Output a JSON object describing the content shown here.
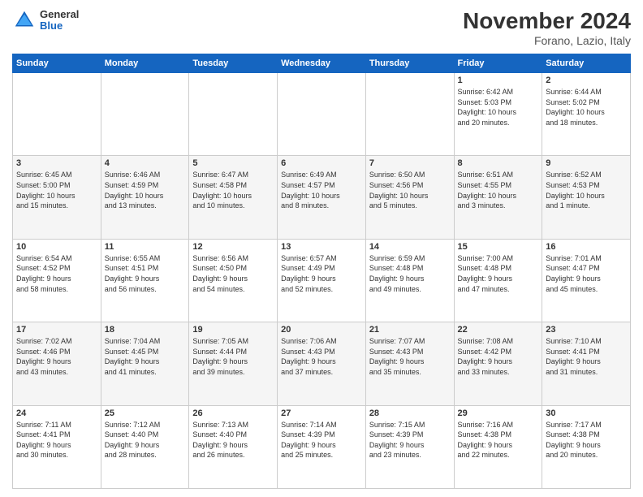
{
  "header": {
    "logo_general": "General",
    "logo_blue": "Blue",
    "month_title": "November 2024",
    "location": "Forano, Lazio, Italy"
  },
  "calendar": {
    "days_of_week": [
      "Sunday",
      "Monday",
      "Tuesday",
      "Wednesday",
      "Thursday",
      "Friday",
      "Saturday"
    ],
    "weeks": [
      [
        {
          "day": "",
          "info": ""
        },
        {
          "day": "",
          "info": ""
        },
        {
          "day": "",
          "info": ""
        },
        {
          "day": "",
          "info": ""
        },
        {
          "day": "",
          "info": ""
        },
        {
          "day": "1",
          "info": "Sunrise: 6:42 AM\nSunset: 5:03 PM\nDaylight: 10 hours\nand 20 minutes."
        },
        {
          "day": "2",
          "info": "Sunrise: 6:44 AM\nSunset: 5:02 PM\nDaylight: 10 hours\nand 18 minutes."
        }
      ],
      [
        {
          "day": "3",
          "info": "Sunrise: 6:45 AM\nSunset: 5:00 PM\nDaylight: 10 hours\nand 15 minutes."
        },
        {
          "day": "4",
          "info": "Sunrise: 6:46 AM\nSunset: 4:59 PM\nDaylight: 10 hours\nand 13 minutes."
        },
        {
          "day": "5",
          "info": "Sunrise: 6:47 AM\nSunset: 4:58 PM\nDaylight: 10 hours\nand 10 minutes."
        },
        {
          "day": "6",
          "info": "Sunrise: 6:49 AM\nSunset: 4:57 PM\nDaylight: 10 hours\nand 8 minutes."
        },
        {
          "day": "7",
          "info": "Sunrise: 6:50 AM\nSunset: 4:56 PM\nDaylight: 10 hours\nand 5 minutes."
        },
        {
          "day": "8",
          "info": "Sunrise: 6:51 AM\nSunset: 4:55 PM\nDaylight: 10 hours\nand 3 minutes."
        },
        {
          "day": "9",
          "info": "Sunrise: 6:52 AM\nSunset: 4:53 PM\nDaylight: 10 hours\nand 1 minute."
        }
      ],
      [
        {
          "day": "10",
          "info": "Sunrise: 6:54 AM\nSunset: 4:52 PM\nDaylight: 9 hours\nand 58 minutes."
        },
        {
          "day": "11",
          "info": "Sunrise: 6:55 AM\nSunset: 4:51 PM\nDaylight: 9 hours\nand 56 minutes."
        },
        {
          "day": "12",
          "info": "Sunrise: 6:56 AM\nSunset: 4:50 PM\nDaylight: 9 hours\nand 54 minutes."
        },
        {
          "day": "13",
          "info": "Sunrise: 6:57 AM\nSunset: 4:49 PM\nDaylight: 9 hours\nand 52 minutes."
        },
        {
          "day": "14",
          "info": "Sunrise: 6:59 AM\nSunset: 4:48 PM\nDaylight: 9 hours\nand 49 minutes."
        },
        {
          "day": "15",
          "info": "Sunrise: 7:00 AM\nSunset: 4:48 PM\nDaylight: 9 hours\nand 47 minutes."
        },
        {
          "day": "16",
          "info": "Sunrise: 7:01 AM\nSunset: 4:47 PM\nDaylight: 9 hours\nand 45 minutes."
        }
      ],
      [
        {
          "day": "17",
          "info": "Sunrise: 7:02 AM\nSunset: 4:46 PM\nDaylight: 9 hours\nand 43 minutes."
        },
        {
          "day": "18",
          "info": "Sunrise: 7:04 AM\nSunset: 4:45 PM\nDaylight: 9 hours\nand 41 minutes."
        },
        {
          "day": "19",
          "info": "Sunrise: 7:05 AM\nSunset: 4:44 PM\nDaylight: 9 hours\nand 39 minutes."
        },
        {
          "day": "20",
          "info": "Sunrise: 7:06 AM\nSunset: 4:43 PM\nDaylight: 9 hours\nand 37 minutes."
        },
        {
          "day": "21",
          "info": "Sunrise: 7:07 AM\nSunset: 4:43 PM\nDaylight: 9 hours\nand 35 minutes."
        },
        {
          "day": "22",
          "info": "Sunrise: 7:08 AM\nSunset: 4:42 PM\nDaylight: 9 hours\nand 33 minutes."
        },
        {
          "day": "23",
          "info": "Sunrise: 7:10 AM\nSunset: 4:41 PM\nDaylight: 9 hours\nand 31 minutes."
        }
      ],
      [
        {
          "day": "24",
          "info": "Sunrise: 7:11 AM\nSunset: 4:41 PM\nDaylight: 9 hours\nand 30 minutes."
        },
        {
          "day": "25",
          "info": "Sunrise: 7:12 AM\nSunset: 4:40 PM\nDaylight: 9 hours\nand 28 minutes."
        },
        {
          "day": "26",
          "info": "Sunrise: 7:13 AM\nSunset: 4:40 PM\nDaylight: 9 hours\nand 26 minutes."
        },
        {
          "day": "27",
          "info": "Sunrise: 7:14 AM\nSunset: 4:39 PM\nDaylight: 9 hours\nand 25 minutes."
        },
        {
          "day": "28",
          "info": "Sunrise: 7:15 AM\nSunset: 4:39 PM\nDaylight: 9 hours\nand 23 minutes."
        },
        {
          "day": "29",
          "info": "Sunrise: 7:16 AM\nSunset: 4:38 PM\nDaylight: 9 hours\nand 22 minutes."
        },
        {
          "day": "30",
          "info": "Sunrise: 7:17 AM\nSunset: 4:38 PM\nDaylight: 9 hours\nand 20 minutes."
        }
      ]
    ]
  }
}
